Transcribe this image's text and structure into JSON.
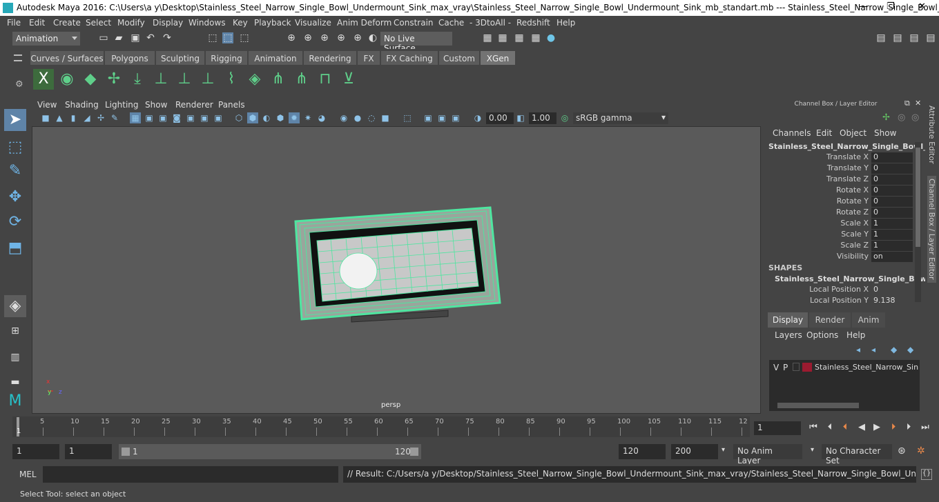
{
  "window": {
    "title": "Autodesk Maya 2016: C:\\Users\\a y\\Desktop\\Stainless_Steel_Narrow_Single_Bowl_Undermount_Sink_max_vray\\Stainless_Steel_Narrow_Single_Bowl_Undermount_Sink_mb_standart.mb   ---   Stainless_Steel_Narrow_Single_Bowl_...",
    "minimize": "—",
    "maximize": "❐",
    "close": "✕"
  },
  "menubar": [
    "File",
    "Edit",
    "Create",
    "Select",
    "Modify",
    "Display",
    "Windows",
    "Key",
    "Playback",
    "Visualize",
    "Anim Deform",
    "Constrain",
    "Cache",
    "- 3DtoAll -",
    "Redshift",
    "Help"
  ],
  "statusline": {
    "mode": "Animation",
    "live_surface": "No Live Surface"
  },
  "shelf_tabs": [
    "Curves / Surfaces",
    "Polygons",
    "Sculpting",
    "Rigging",
    "Animation",
    "Rendering",
    "FX",
    "FX Caching",
    "Custom",
    "XGen"
  ],
  "shelf_active": "XGen",
  "viewport": {
    "menu": [
      "View",
      "Shading",
      "Lighting",
      "Show",
      "Renderer",
      "Panels"
    ],
    "field1": "0.00",
    "field2": "1.00",
    "colorspace": "sRGB gamma",
    "camera": "persp",
    "axis_x": "x",
    "axis_y": "y",
    "axis_z": "z"
  },
  "channel_box": {
    "title": "Channel Box / Layer Editor",
    "menu": [
      "Channels",
      "Edit",
      "Object",
      "Show"
    ],
    "object": "Stainless_Steel_Narrow_Single_Bowl_...",
    "attributes": [
      {
        "name": "Translate X",
        "value": "0"
      },
      {
        "name": "Translate Y",
        "value": "0"
      },
      {
        "name": "Translate Z",
        "value": "0"
      },
      {
        "name": "Rotate X",
        "value": "0"
      },
      {
        "name": "Rotate Y",
        "value": "0"
      },
      {
        "name": "Rotate Z",
        "value": "0"
      },
      {
        "name": "Scale X",
        "value": "1"
      },
      {
        "name": "Scale Y",
        "value": "1"
      },
      {
        "name": "Scale Z",
        "value": "1"
      },
      {
        "name": "Visibility",
        "value": "on"
      }
    ],
    "shapes_header": "SHAPES",
    "shape_name": "Stainless_Steel_Narrow_Single_Bowl...",
    "shape_attributes": [
      {
        "name": "Local Position X",
        "value": "0"
      },
      {
        "name": "Local Position Y",
        "value": "9.138"
      }
    ]
  },
  "layer_editor": {
    "tabs": [
      "Display",
      "Render",
      "Anim"
    ],
    "active_tab": "Display",
    "menu": [
      "Layers",
      "Options",
      "Help"
    ],
    "layer": {
      "v": "V",
      "p": "P",
      "name": "Stainless_Steel_Narrow_Single",
      "color": "#9b1b30"
    }
  },
  "side_tabs": [
    "Attribute Editor",
    "Channel Box / Layer Editor"
  ],
  "timeline": {
    "ticks": [
      "5",
      "10",
      "15",
      "20",
      "25",
      "30",
      "35",
      "40",
      "45",
      "50",
      "55",
      "60",
      "65",
      "70",
      "75",
      "80",
      "85",
      "90",
      "95",
      "100",
      "105",
      "110",
      "115",
      "12"
    ],
    "start_label": "1",
    "current_frame": "1"
  },
  "range": {
    "start": "1",
    "playback_start": "1",
    "slider_start": "1",
    "slider_end": "120",
    "playback_end": "120",
    "end": "200",
    "anim_layer": "No Anim Layer",
    "character_set": "No Character Set"
  },
  "command": {
    "label": "MEL",
    "result": "// Result: C:/Users/a y/Desktop/Stainless_Steel_Narrow_Single_Bowl_Undermount_Sink_max_vray/Stainless_Steel_Narrow_Single_Bowl_Undermount_Sink_mb_sta"
  },
  "help_line": "Select Tool: select an object",
  "colors": {
    "accent": "#5fcf8a",
    "selection": "#5f84a8",
    "wireframe": "#4ee6a0"
  }
}
